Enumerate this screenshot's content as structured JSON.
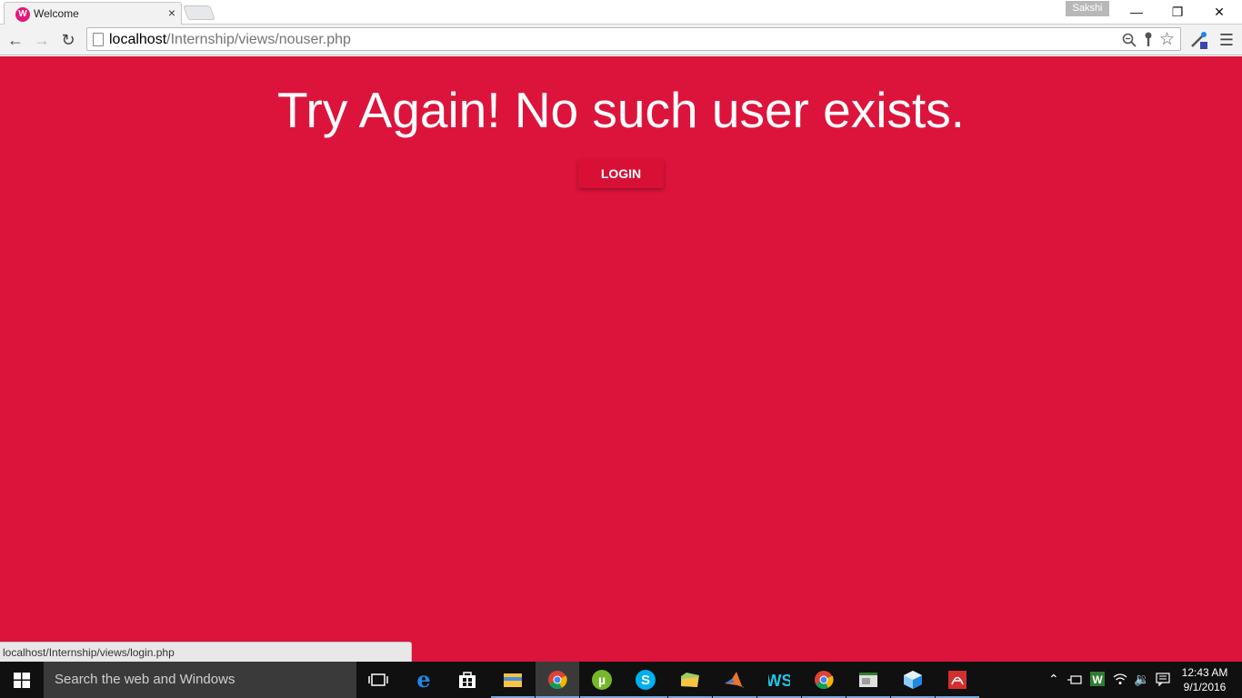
{
  "browser": {
    "tab_title": "Welcome",
    "tab_close": "×",
    "profile_name": "Sakshi",
    "window_controls": {
      "minimize": "—",
      "restore": "❐",
      "close": "✕"
    },
    "url_host": "localhost",
    "url_path": "/Internship/views/nouser.php"
  },
  "page": {
    "background_color": "#dc143c",
    "heading": "Try Again! No such user exists.",
    "login_button": "LOGIN",
    "status_url": "localhost/Internship/views/login.php"
  },
  "taskbar": {
    "search_placeholder": "Search the web and Windows",
    "time": "12:43 AM",
    "date": "9/1/2016",
    "apps": [
      "task-view",
      "edge",
      "store",
      "file-explorer",
      "chrome",
      "utorrent",
      "skype",
      "folder",
      "matlab",
      "webstorm",
      "chrome",
      "app",
      "virtualbox",
      "acrobat"
    ]
  }
}
